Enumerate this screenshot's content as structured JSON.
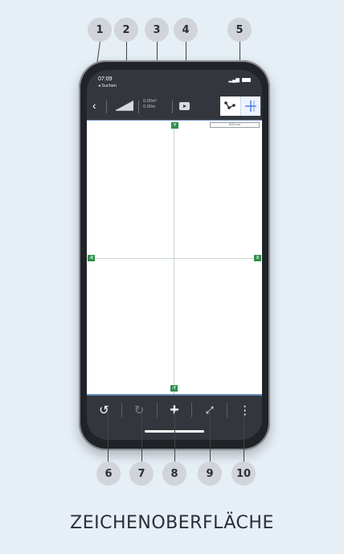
{
  "callouts_top": [
    "1",
    "2",
    "3",
    "4",
    "5"
  ],
  "callouts_bottom": [
    "6",
    "7",
    "8",
    "9",
    "10"
  ],
  "status_bar": {
    "time": "07:09",
    "back_app": "◂ Suchen"
  },
  "toolbar": {
    "area": "0.00m²",
    "length": "0.00m"
  },
  "canvas": {
    "axis_labels": {
      "top": "Y",
      "bottom": "-Y",
      "left": "-X",
      "right": "X"
    },
    "scale_label": "5000 mm"
  },
  "bottom_toolbar": {
    "undo": "↺",
    "redo": "↻",
    "add": "+",
    "fit": "⤢",
    "more": "⋮"
  },
  "caption": "ZEICHENOBERFLÄCHE",
  "colors": {
    "background": "#e6eef6",
    "accent_green": "#2f8f4e",
    "accent_blue": "#6c8fc0"
  }
}
